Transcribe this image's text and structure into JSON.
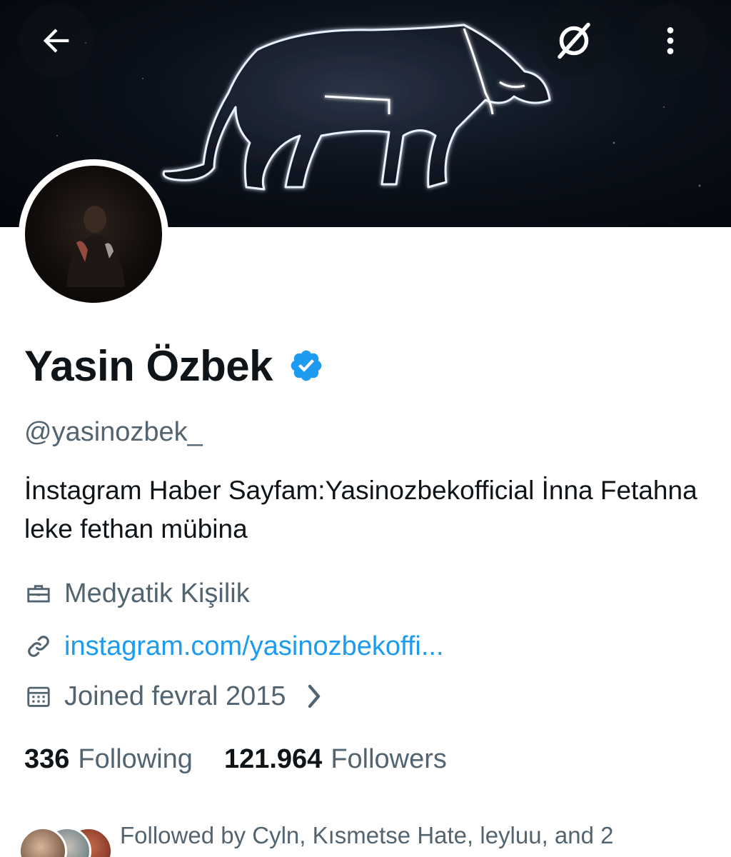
{
  "profile": {
    "display_name": "Yasin Özbek",
    "handle": "@yasinozbek_",
    "bio": "İnstagram Haber Sayfam:Yasinozbekofficial İnna Fetahna leke fethan mübina",
    "professional_category": "Medyatik Kişilik",
    "link": "instagram.com/yasinozbekoffi...",
    "joined": "Joined fevral 2015",
    "verified": true
  },
  "stats": {
    "following_count": "336",
    "following_label": "Following",
    "followers_count": "121.964",
    "followers_label": "Followers"
  },
  "followed_by": "Followed by Cyln, Kısmetse Hate, leyluu, and 2",
  "icons": {
    "back": "back-arrow-icon",
    "grok": "grok-icon",
    "more": "more-vertical-icon",
    "verified": "verified-badge-icon",
    "professional": "briefcase-icon",
    "link": "link-icon",
    "calendar": "calendar-icon",
    "chevron": "chevron-right-icon"
  },
  "colors": {
    "verified_blue": "#1d9bf0",
    "link_blue": "#1d9bf0",
    "secondary_text": "#536471",
    "primary_text": "#0f1419"
  }
}
